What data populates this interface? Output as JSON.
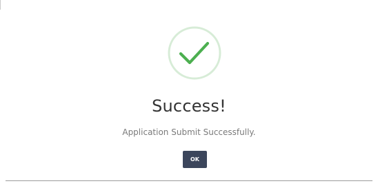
{
  "dialog": {
    "icon": "check-circle-icon",
    "icon_color": "#4caf50",
    "icon_ring_color": "#d7ecd7",
    "title": "Success!",
    "message": "Application Submit Successfully.",
    "ok_label": "OK",
    "button_color": "#3c465c"
  }
}
